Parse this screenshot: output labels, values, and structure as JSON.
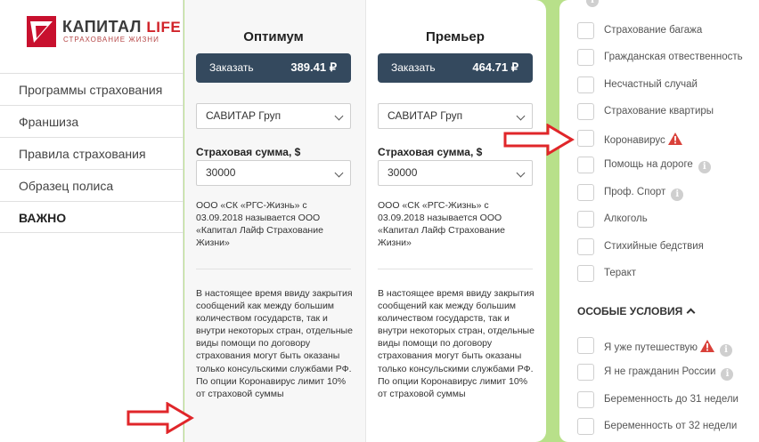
{
  "brand": {
    "name_main": "КАПИТАЛ ",
    "name_accent": "LIFE",
    "tagline": "СТРАХОВАНИЕ ЖИЗНИ"
  },
  "nav": {
    "items": [
      {
        "label": "Программы страхования"
      },
      {
        "label": "Франшиза"
      },
      {
        "label": "Правила страхования"
      },
      {
        "label": "Образец полиса"
      },
      {
        "label": "ВАЖНО"
      }
    ]
  },
  "plans": [
    {
      "title": "Оптимум",
      "order_label": "Заказать",
      "price": "389.41 ₽",
      "assistance": "САВИТАР Груп",
      "sum_label": "Страховая сумма, $",
      "sum_value": "30000",
      "note1": "ООО «СК «РГС-Жизнь» с 03.09.2018 называется ООО «Капитал Лайф Страхование Жизни»",
      "note2": "В настоящее время ввиду закрытия сообщений как между большим количеством государств, так и внутри некоторых стран, отдельные виды помощи по договору страхования могут быть оказаны только консульскими службами РФ.",
      "note3": "По опции Коронавирус лимит 10% от страховой суммы"
    },
    {
      "title": "Премьер",
      "order_label": "Заказать",
      "price": "464.71 ₽",
      "assistance": "САВИТАР Груп",
      "sum_label": "Страховая сумма, $",
      "sum_value": "30000",
      "note1": "ООО «СК «РГС-Жизнь» с 03.09.2018 называется ООО «Капитал Лайф Страхование Жизни»",
      "note2": "В настоящее время ввиду закрытия сообщений как между большим количеством государств, так и внутри некоторых стран, отдельные виды помощи по договору страхования могут быть оказаны только консульскими службами РФ.",
      "note3": "По опции Коронавирус лимит 10% от страховой суммы"
    }
  ],
  "options": [
    {
      "label": "Страхование багажа"
    },
    {
      "label": "Гражданская отвественность"
    },
    {
      "label": "Несчастный случай"
    },
    {
      "label": "Страхование квартиры"
    },
    {
      "label": "Коронавирус",
      "icon": "warning-icon"
    },
    {
      "label": "Помощь на дороге",
      "icon": "info-icon"
    },
    {
      "label": "Проф. Спорт",
      "icon": "info-icon"
    },
    {
      "label": "Алкоголь"
    },
    {
      "label": "Стихийные бедствия"
    },
    {
      "label": "Теракт"
    }
  ],
  "special": {
    "heading": "ОСОБЫЕ УСЛОВИЯ",
    "items": [
      {
        "label": "Я уже путешествую",
        "icon": "warning-icon",
        "icon2": "info-icon"
      },
      {
        "label": "Я не гражданин России",
        "icon": "info-icon"
      },
      {
        "label": "Беременность до 31 недели"
      },
      {
        "label": "Беременность от 32 недели"
      }
    ]
  },
  "info_glyph": "i",
  "colors": {
    "order_button": "#34495e",
    "background": "#b8e08a",
    "arrow": "#e0262a",
    "warning": "#d9413a",
    "brand_red": "#c8102e"
  }
}
